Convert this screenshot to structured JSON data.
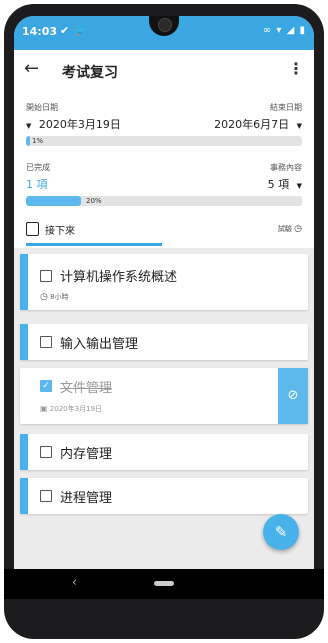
{
  "status_bar": {
    "time": "14:03",
    "left_icons": "✔ 🐦",
    "right_icons": "∞ ▾ ◢ ▮"
  },
  "app_bar": {
    "title": "考试复习"
  },
  "dates": {
    "start_label": "開始日期",
    "start_value": "2020年3月19日",
    "end_label": "結束日期",
    "end_value": "2020年6月7日",
    "time_progress_text": "1%",
    "time_progress": 0.01
  },
  "items_summary": {
    "done_label": "已完成",
    "done_value": "1 項",
    "total_label": "事務內容",
    "total_value": "5 項",
    "progress_text": "20%",
    "progress": 0.2
  },
  "tabs": {
    "main_label": "接下來",
    "right_label": "試驗"
  },
  "tasks": [
    {
      "name": "计算机操作系统概述",
      "meta": "8小時",
      "done": false
    },
    {
      "name": "输入输出管理",
      "done": false
    },
    {
      "name": "文件管理",
      "meta": "2020年3月19日",
      "done": true
    },
    {
      "name": "内存管理",
      "done": false
    },
    {
      "name": "进程管理",
      "done": false
    }
  ],
  "colors": {
    "accent": "#3aa6e2",
    "bar_fill": "#5db8ec"
  }
}
